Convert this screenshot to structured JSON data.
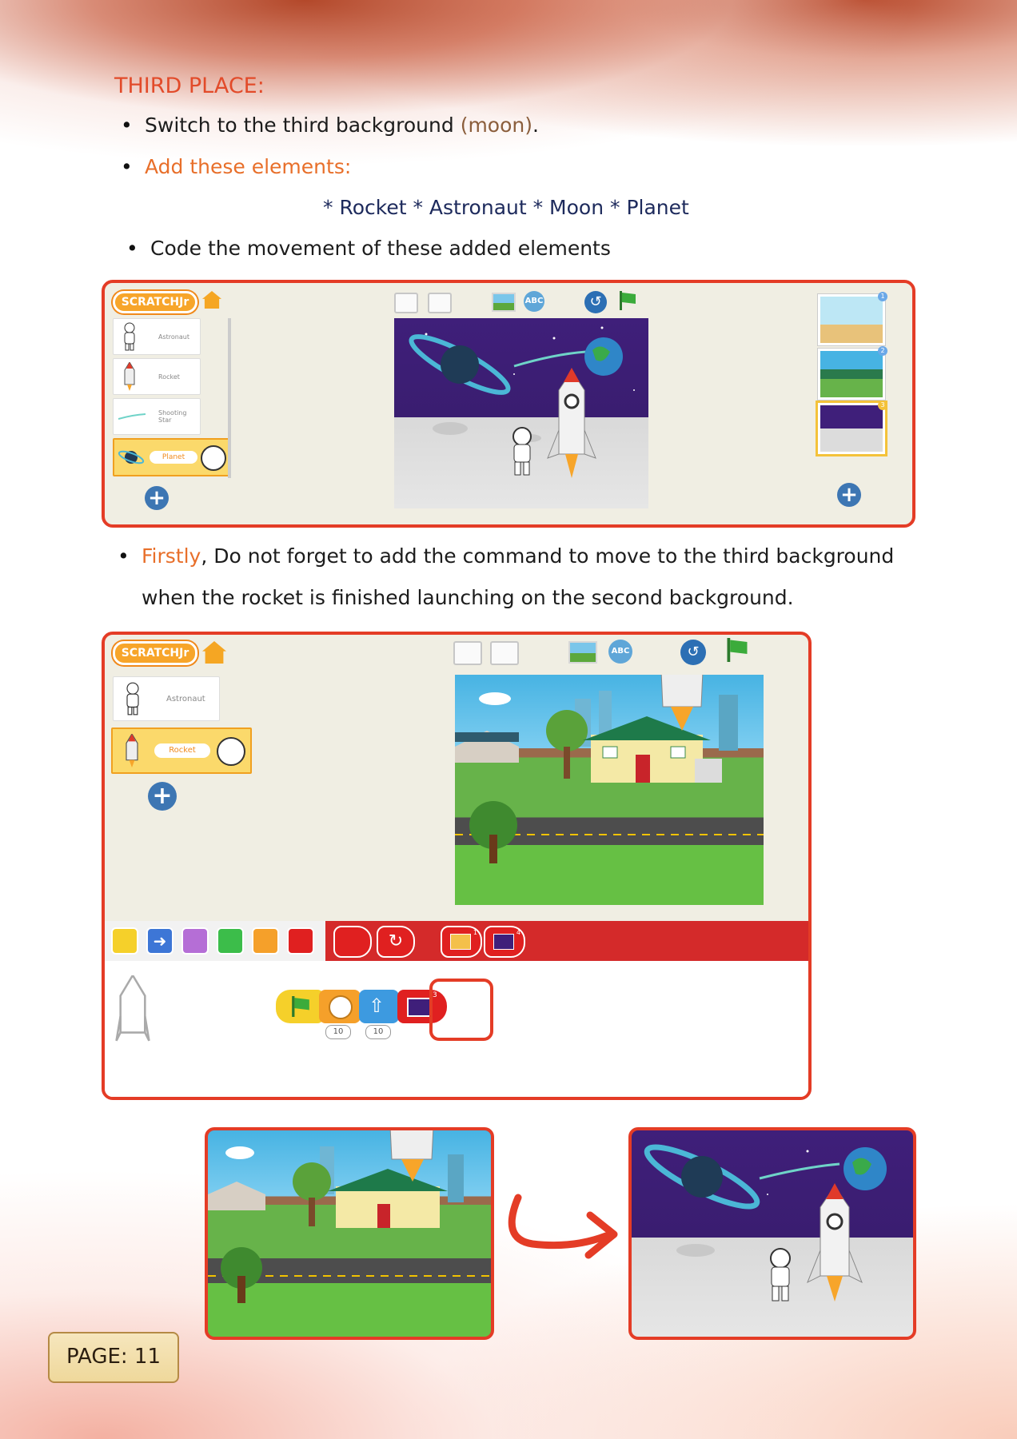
{
  "heading": "THIRD PLACE:",
  "bullet1": {
    "before": "Switch to the third background ",
    "highlight": "(moon)",
    "after": "."
  },
  "bullet2": "Add these elements:",
  "elements_line": "* Rocket * Astronaut * Moon * Planet",
  "bullet3": "Code the movement of these added elements",
  "bullet4": {
    "highlight": "Firstly",
    "rest_line1": ", Do not forget to add the command to move to the third background",
    "line2": "when the rocket is finished launching on the second background."
  },
  "app": {
    "logo": "SCRATCHJr",
    "screen1": {
      "sprites": [
        "Astronaut",
        "Rocket",
        "Shooting Star",
        "Planet"
      ],
      "scene_numbers": [
        "1",
        "2",
        "3"
      ]
    },
    "screen2": {
      "sprites": [
        "Astronaut",
        "Rocket"
      ],
      "tool_abc": "ABC",
      "badge_numbers": [
        "10",
        "10"
      ],
      "goto_page_numbers": [
        "1",
        "4",
        "3"
      ]
    }
  },
  "footer": {
    "page_label": "PAGE: 11"
  },
  "colors": {
    "accent_red": "#e43c26",
    "orange": "#e86f2a",
    "navy": "#1d2a5c"
  }
}
